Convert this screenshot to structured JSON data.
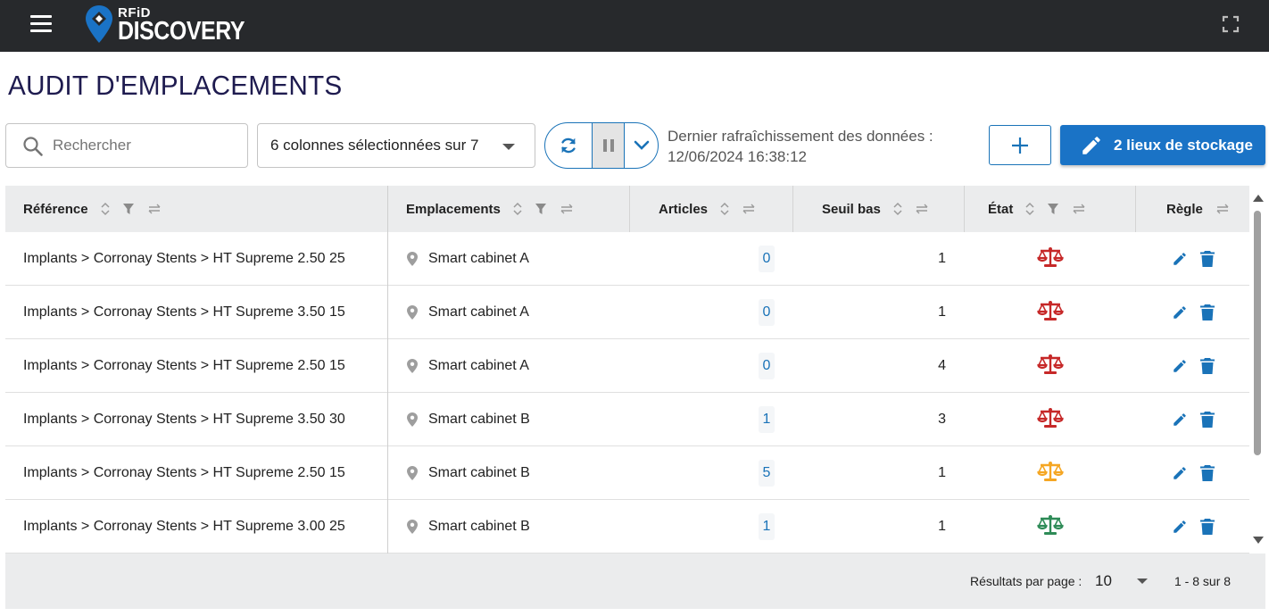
{
  "app": {
    "brand_small": "RFiD",
    "brand_big": "DISCOVERY",
    "colors": {
      "topbar": "#27292c",
      "accent": "#1a73c6",
      "status_red": "#c62828",
      "status_orange": "#f5a623",
      "status_green": "#2e8b57"
    }
  },
  "page": {
    "title": "AUDIT D'EMPLACEMENTS"
  },
  "toolbar": {
    "search_placeholder": "Rechercher",
    "columns_select": "6 colonnes sélectionnées sur 7",
    "refresh_label": "Dernier rafraîchissement des données :",
    "refresh_time": "12/06/2024 16:38:12",
    "storage_button": "2 lieux de stockage"
  },
  "table": {
    "headers": {
      "reference": "Référence",
      "locations": "Emplacements",
      "articles": "Articles",
      "low_threshold": "Seuil bas",
      "state": "État",
      "rule": "Règle"
    },
    "rows": [
      {
        "reference": "Implants > Corronay Stents > HT Supreme 2.50 25",
        "location": "Smart cabinet A",
        "articles": "0",
        "threshold": "1",
        "state": "red"
      },
      {
        "reference": "Implants > Corronay Stents > HT Supreme 3.50 15",
        "location": "Smart cabinet A",
        "articles": "0",
        "threshold": "1",
        "state": "red"
      },
      {
        "reference": "Implants > Corronay Stents > HT Supreme 2.50 15",
        "location": "Smart cabinet A",
        "articles": "0",
        "threshold": "4",
        "state": "red"
      },
      {
        "reference": "Implants > Corronay Stents > HT Supreme 3.50 30",
        "location": "Smart cabinet B",
        "articles": "1",
        "threshold": "3",
        "state": "red"
      },
      {
        "reference": "Implants > Corronay Stents > HT Supreme 2.50 15",
        "location": "Smart cabinet B",
        "articles": "5",
        "threshold": "1",
        "state": "orange"
      },
      {
        "reference": "Implants > Corronay Stents > HT Supreme 3.00 25",
        "location": "Smart cabinet B",
        "articles": "1",
        "threshold": "1",
        "state": "green"
      }
    ]
  },
  "footer": {
    "rows_per_page_label": "Résultats par page :",
    "rows_per_page_value": "10",
    "range": "1 - 8 sur 8"
  }
}
